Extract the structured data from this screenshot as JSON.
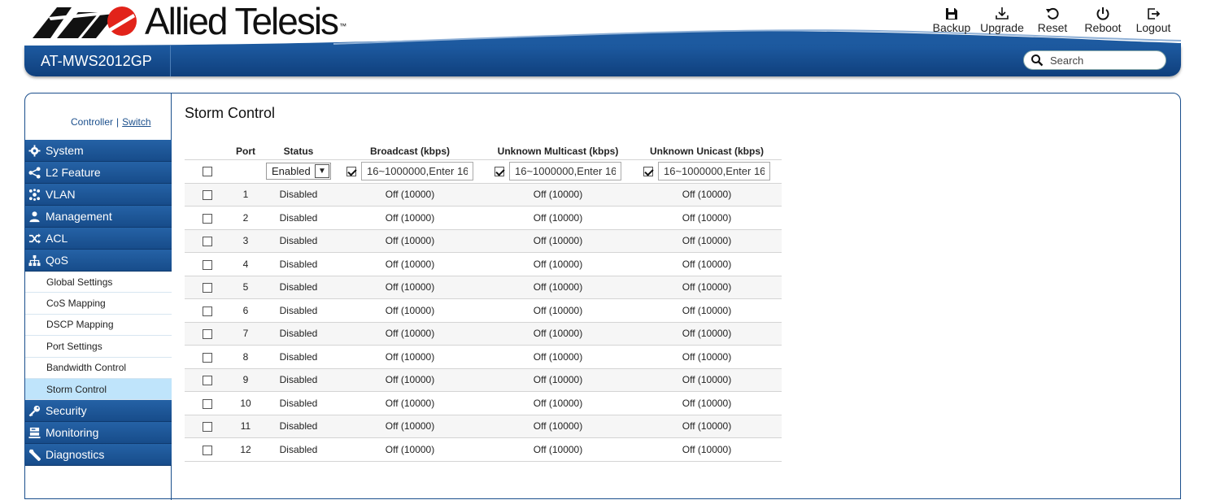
{
  "brand": {
    "name": "Allied Telesis",
    "tm": "™"
  },
  "actions": [
    {
      "label": "Backup",
      "icon": "floppy-disk-icon"
    },
    {
      "label": "Upgrade",
      "icon": "download-icon"
    },
    {
      "label": "Reset",
      "icon": "undo-icon"
    },
    {
      "label": "Reboot",
      "icon": "power-icon"
    },
    {
      "label": "Logout",
      "icon": "logout-icon"
    }
  ],
  "header": {
    "model": "AT-MWS2012GP",
    "search_placeholder": "Search"
  },
  "mode": {
    "controller": "Controller",
    "separator": "|",
    "switch": "Switch"
  },
  "nav": {
    "system": "System",
    "l2": "L2 Feature",
    "vlan": "VLAN",
    "management": "Management",
    "acl": "ACL",
    "qos": "QoS",
    "qos_sub": [
      "Global Settings",
      "CoS Mapping",
      "DSCP Mapping",
      "Port Settings",
      "Bandwidth Control",
      "Storm Control"
    ],
    "security": "Security",
    "monitoring": "Monitoring",
    "diagnostics": "Diagnostics"
  },
  "page": {
    "title": "Storm Control"
  },
  "table": {
    "headers": [
      "Port",
      "Status",
      "Broadcast (kbps)",
      "Unknown Multicast (kbps)",
      "Unknown Unicast (kbps)"
    ],
    "edit": {
      "status": "Enabled",
      "rate_value": "16~1000000,Enter 16"
    },
    "rows": [
      {
        "port": "1",
        "status": "Disabled",
        "bc": "Off (10000)",
        "mc": "Off (10000)",
        "uc": "Off (10000)"
      },
      {
        "port": "2",
        "status": "Disabled",
        "bc": "Off (10000)",
        "mc": "Off (10000)",
        "uc": "Off (10000)"
      },
      {
        "port": "3",
        "status": "Disabled",
        "bc": "Off (10000)",
        "mc": "Off (10000)",
        "uc": "Off (10000)"
      },
      {
        "port": "4",
        "status": "Disabled",
        "bc": "Off (10000)",
        "mc": "Off (10000)",
        "uc": "Off (10000)"
      },
      {
        "port": "5",
        "status": "Disabled",
        "bc": "Off (10000)",
        "mc": "Off (10000)",
        "uc": "Off (10000)"
      },
      {
        "port": "6",
        "status": "Disabled",
        "bc": "Off (10000)",
        "mc": "Off (10000)",
        "uc": "Off (10000)"
      },
      {
        "port": "7",
        "status": "Disabled",
        "bc": "Off (10000)",
        "mc": "Off (10000)",
        "uc": "Off (10000)"
      },
      {
        "port": "8",
        "status": "Disabled",
        "bc": "Off (10000)",
        "mc": "Off (10000)",
        "uc": "Off (10000)"
      },
      {
        "port": "9",
        "status": "Disabled",
        "bc": "Off (10000)",
        "mc": "Off (10000)",
        "uc": "Off (10000)"
      },
      {
        "port": "10",
        "status": "Disabled",
        "bc": "Off (10000)",
        "mc": "Off (10000)",
        "uc": "Off (10000)"
      },
      {
        "port": "11",
        "status": "Disabled",
        "bc": "Off (10000)",
        "mc": "Off (10000)",
        "uc": "Off (10000)"
      },
      {
        "port": "12",
        "status": "Disabled",
        "bc": "Off (10000)",
        "mc": "Off (10000)",
        "uc": "Off (10000)"
      }
    ]
  },
  "colors": {
    "brand_blue": "#1b4f8c",
    "active_sub": "#bfe4fb",
    "logo_red": "#e2231a"
  }
}
